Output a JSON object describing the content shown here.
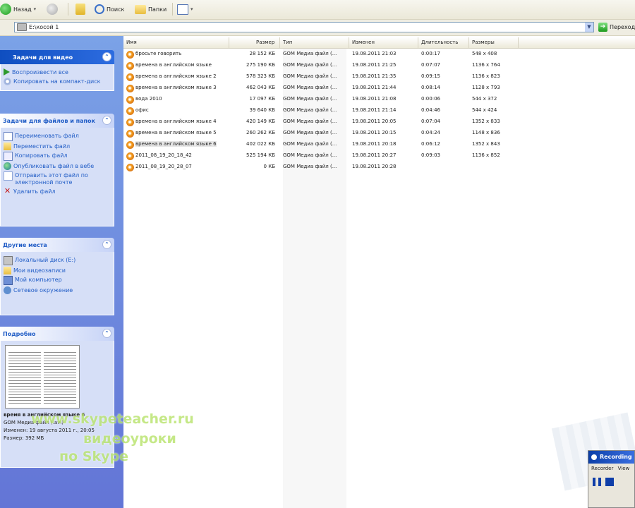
{
  "toolbar": {
    "back_label": "Назад",
    "search_label": "Поиск",
    "folders_label": "Папки"
  },
  "addressbar": {
    "path": "E:\\косой 1",
    "go_label": "Переход"
  },
  "taskpane": {
    "video_tasks": {
      "title": "Задачи для видео",
      "items": [
        "Воспроизвести все",
        "Копировать на компакт-диск"
      ]
    },
    "file_tasks": {
      "title": "Задачи для файлов и папок",
      "items": [
        "Переименовать файл",
        "Переместить файл",
        "Копировать файл",
        "Опубликовать файл в вебе",
        "Отправить этот файл по электронной почте",
        "Удалить файл"
      ]
    },
    "other_places": {
      "title": "Другие места",
      "items": [
        "Локальный диск (E:)",
        "Мои видеозаписи",
        "Мой компьютер",
        "Сетевое окружение"
      ]
    },
    "details": {
      "title": "Подробно",
      "name": "время в английском языке 6",
      "type": "GOM Медиа файл (.avi)",
      "modified": "Изменен: 19 августа 2011 г., 20:05",
      "size": "Размер: 392 МБ"
    }
  },
  "filelist": {
    "columns": [
      "Имя",
      "Размер",
      "Тип",
      "Изменен",
      "Длительность",
      "Размеры"
    ],
    "rows": [
      {
        "name": "бросьте говорить",
        "size": "28 152 КБ",
        "type": "GOM Медиа файл (...",
        "modified": "19.08.2011 21:03",
        "duration": "0:00:17",
        "dims": "548 x 408"
      },
      {
        "name": "времена в английском языке",
        "size": "275 190 КБ",
        "type": "GOM Медиа файл (...",
        "modified": "19.08.2011 21:25",
        "duration": "0:07:07",
        "dims": "1136 x 764"
      },
      {
        "name": "времена в английском языке 2",
        "size": "578 323 КБ",
        "type": "GOM Медиа файл (...",
        "modified": "19.08.2011 21:35",
        "duration": "0:09:15",
        "dims": "1136 x 823"
      },
      {
        "name": "времена в английском языке 3",
        "size": "462 043 КБ",
        "type": "GOM Медиа файл (...",
        "modified": "19.08.2011 21:44",
        "duration": "0:08:14",
        "dims": "1128 x 793"
      },
      {
        "name": "вода 2010",
        "size": "17 097 КБ",
        "type": "GOM Медиа файл (...",
        "modified": "19.08.2011 21:08",
        "duration": "0:00:06",
        "dims": "544 x 372"
      },
      {
        "name": "офис",
        "size": "39 640 КБ",
        "type": "GOM Медиа файл (...",
        "modified": "19.08.2011 21:14",
        "duration": "0:04:46",
        "dims": "544 x 424"
      },
      {
        "name": "времена в английском языке 4",
        "size": "420 149 КБ",
        "type": "GOM Медиа файл (...",
        "modified": "19.08.2011 20:05",
        "duration": "0:07:04",
        "dims": "1352 x 833"
      },
      {
        "name": "времена в английском языке 5",
        "size": "260 262 КБ",
        "type": "GOM Медиа файл (...",
        "modified": "19.08.2011 20:15",
        "duration": "0:04:24",
        "dims": "1148 x 836"
      },
      {
        "name": "времена в английском языке 6",
        "size": "402 022 КБ",
        "type": "GOM Медиа файл (...",
        "modified": "19.08.2011 20:18",
        "duration": "0:06:12",
        "dims": "1352 x 843"
      },
      {
        "name": "2011_08_19_20_18_42",
        "size": "525 194 КБ",
        "type": "GOM Медиа файл (...",
        "modified": "19.08.2011 20:27",
        "duration": "0:09:03",
        "dims": "1136 x 852"
      },
      {
        "name": "2011_08_19_20_28_07",
        "size": "0 КБ",
        "type": "GOM Медиа файл (...",
        "modified": "19.08.2011 20:28",
        "duration": "",
        "dims": ""
      }
    ]
  },
  "watermark": {
    "line1": "www.skypeteacher.ru",
    "line2": "видеоуроки",
    "line3": "по Skype"
  },
  "recorder": {
    "title": "Recording",
    "menu": [
      "Recorder",
      "View"
    ]
  }
}
